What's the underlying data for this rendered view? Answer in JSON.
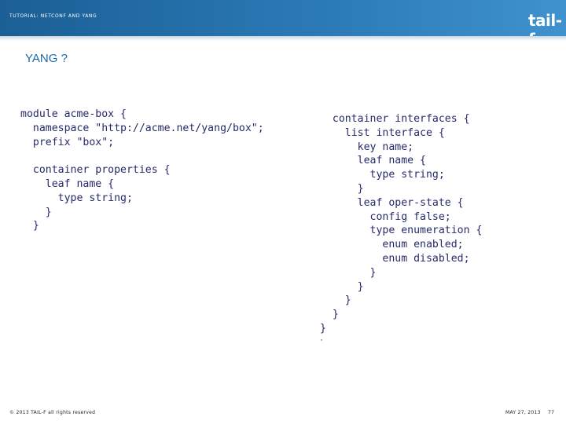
{
  "header": {
    "tutorial_title": "TUTORIAL: NETCONF AND YANG",
    "logo_text": "tail-f"
  },
  "slide": {
    "title": "YANG ?"
  },
  "code": {
    "left": "module acme-box {\n  namespace \"http://acme.net/yang/box\";\n  prefix \"box\";\n\n  container properties {\n    leaf name {\n      type string;\n    }\n  }\n",
    "right": "  container interfaces {\n    list interface {\n      key name;\n      leaf name {\n        type string;\n      }\n      leaf oper-state {\n        config false;\n        type enumeration {\n          enum enabled;\n          enum disabled;\n        }\n      }\n    }\n  }\n}"
  },
  "footer": {
    "copyright": "© 2013 TAIL-F all rights reserved",
    "date": "MAY 27, 2013",
    "page_number": "77"
  },
  "colors": {
    "header_blue": "#2a79b6",
    "title_blue": "#1a6aaa",
    "code_navy": "#262a6a"
  }
}
